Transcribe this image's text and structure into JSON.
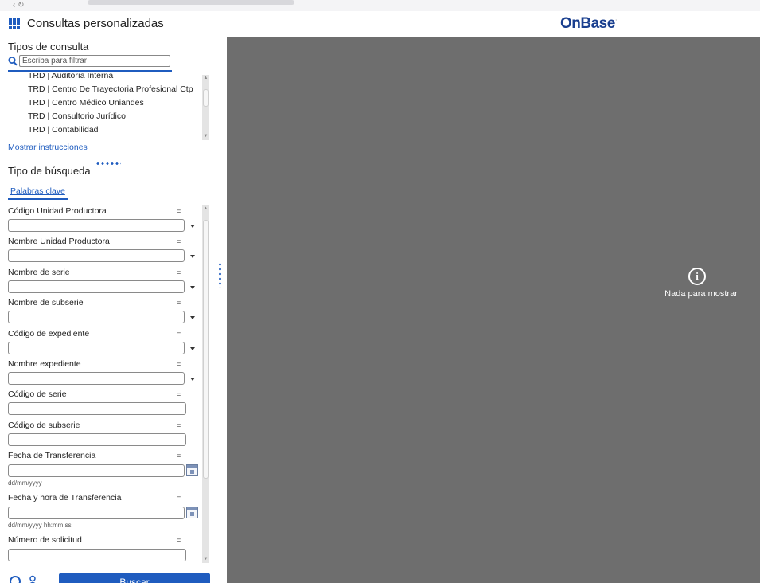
{
  "app": {
    "title": "Consultas personalizadas",
    "logo": "OnBase",
    "logo_mark": "·"
  },
  "query_types": {
    "heading": "Tipos de consulta",
    "filter_placeholder": "Escriba para filtrar",
    "items": [
      "TRD | Auditoría Interna",
      "TRD | Centro De Trayectoria Profesional Ctp",
      "TRD | Centro Médico Uniandes",
      "TRD | Consultorio Jurídico",
      "TRD | Contabilidad"
    ],
    "instructions_link": "Mostrar instrucciones"
  },
  "search_type": {
    "heading": "Tipo de búsqueda",
    "tab": "Palabras clave"
  },
  "fields": [
    {
      "label": "Código Unidad Productora",
      "operator": "=",
      "kind": "dropdown"
    },
    {
      "label": "Nombre Unidad Productora",
      "operator": "=",
      "kind": "dropdown"
    },
    {
      "label": "Nombre de serie",
      "operator": "=",
      "kind": "dropdown"
    },
    {
      "label": "Nombre de subserie",
      "operator": "=",
      "kind": "dropdown"
    },
    {
      "label": "Código de expediente",
      "operator": "=",
      "kind": "dropdown"
    },
    {
      "label": "Nombre expediente",
      "operator": "=",
      "kind": "dropdown"
    },
    {
      "label": "Código de serie",
      "operator": "=",
      "kind": "text"
    },
    {
      "label": "Código de subserie",
      "operator": "=",
      "kind": "text"
    },
    {
      "label": "Fecha de Transferencia",
      "operator": "=",
      "kind": "date",
      "hint": "dd/mm/yyyy"
    },
    {
      "label": "Fecha y hora de Transferencia",
      "operator": "=",
      "kind": "date",
      "hint": "dd/mm/yyyy hh:mm:ss"
    },
    {
      "label": "Número de solicitud",
      "operator": "=",
      "kind": "text"
    }
  ],
  "actions": {
    "search_button": "Buscar"
  },
  "viewer": {
    "empty_message": "Nada para mostrar",
    "info_glyph": "i"
  },
  "colors": {
    "accent": "#1f5cbf",
    "viewer_bg": "#6e6e6e",
    "logo": "#1a3f8f"
  },
  "icons": [
    "apps-grid-icon",
    "search-icon",
    "calendar-icon",
    "clock-icon",
    "user-icon",
    "info-icon"
  ]
}
